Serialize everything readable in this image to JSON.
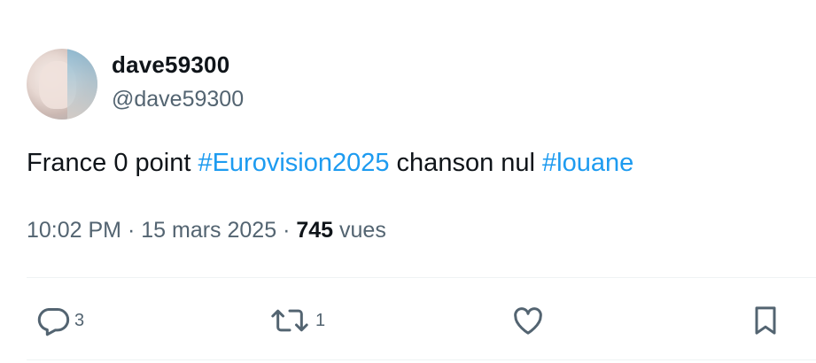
{
  "user": {
    "display_name": "dave59300",
    "handle": "@dave59300"
  },
  "tweet": {
    "text_parts": [
      "France 0 point ",
      "#Eurovision2025",
      " chanson nul ",
      "#louane"
    ],
    "time": "10:02 PM",
    "separator": "·",
    "date": "15 mars 2025",
    "views_count": "745",
    "views_label": "vues"
  },
  "actions": {
    "replies": "3",
    "retweets": "1"
  },
  "colors": {
    "hashtag": "#1d9bf0",
    "muted": "#536471",
    "text": "#0f1419"
  },
  "icons": [
    "reply-icon",
    "retweet-icon",
    "like-icon",
    "bookmark-icon"
  ]
}
